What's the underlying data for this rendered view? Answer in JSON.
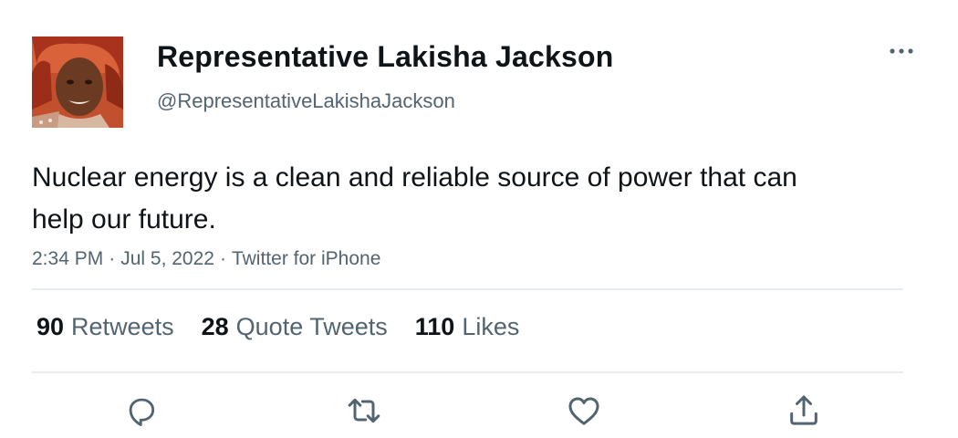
{
  "author": {
    "display_name": "Representative Lakisha Jackson",
    "handle": "@RepresentativeLakishaJackson"
  },
  "tweet": {
    "text": "Nuclear energy is a clean and reliable source of power that can help our future.",
    "time": "2:34 PM",
    "date": "Jul 5, 2022",
    "source": "Twitter for iPhone",
    "separator": "·"
  },
  "stats": {
    "retweets_count": "90",
    "retweets_label": "Retweets",
    "quotes_count": "28",
    "quotes_label": "Quote Tweets",
    "likes_count": "110",
    "likes_label": "Likes"
  },
  "icons": {
    "more": "more-horizontal-icon",
    "reply": "reply-icon",
    "retweet": "retweet-icon",
    "like": "heart-icon",
    "share": "share-icon"
  },
  "colors": {
    "text_primary": "#0f1419",
    "text_secondary": "#536471",
    "divider": "#e6ecf0",
    "icon": "#536471"
  }
}
